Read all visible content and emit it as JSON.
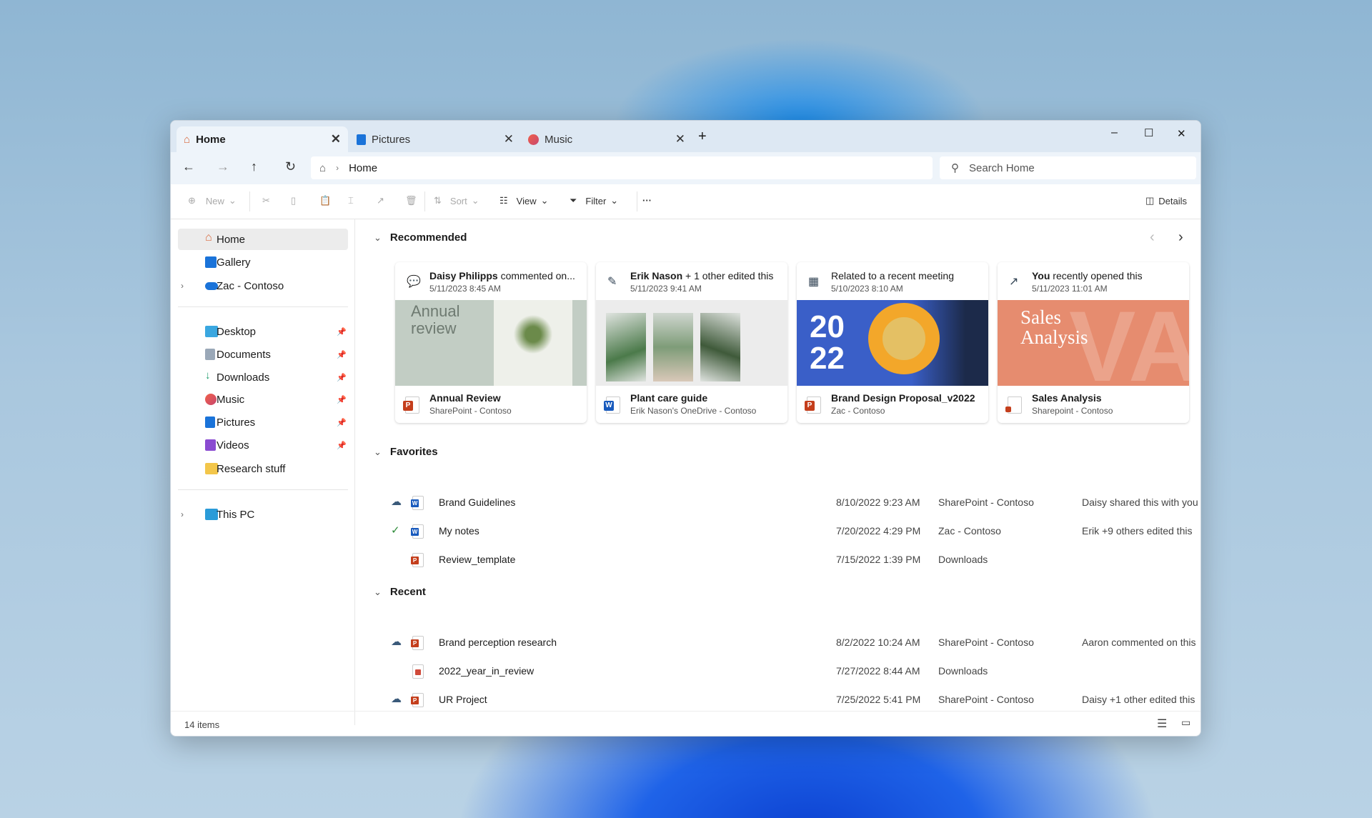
{
  "tabs": [
    {
      "label": "Home",
      "icon": "home-icon",
      "active": true
    },
    {
      "label": "Pictures",
      "icon": "pictures-icon"
    },
    {
      "label": "Music",
      "icon": "music-icon"
    }
  ],
  "window_controls": {
    "minimize": "–",
    "maximize": "☐",
    "close": "✕",
    "new_tab": "+"
  },
  "address": {
    "breadcrumb": [
      "Home"
    ],
    "search_placeholder": "Search Home"
  },
  "toolbar": {
    "new": "New",
    "sort": "Sort",
    "view": "View",
    "filter": "Filter",
    "more": "···",
    "details": "Details"
  },
  "sidebar": {
    "items": [
      {
        "label": "Home",
        "selected": true
      },
      {
        "label": "Gallery"
      },
      {
        "label": "Zac - Contoso"
      },
      {
        "label": "Desktop",
        "pinned": true
      },
      {
        "label": "Documents",
        "pinned": true
      },
      {
        "label": "Downloads",
        "pinned": true
      },
      {
        "label": "Music",
        "pinned": true
      },
      {
        "label": "Pictures",
        "pinned": true
      },
      {
        "label": "Videos",
        "pinned": true
      },
      {
        "label": "Research stuff"
      },
      {
        "label": "This PC"
      }
    ]
  },
  "recommended": {
    "title": "Recommended",
    "cards": [
      {
        "who": "Daisy Philipps",
        "action": " commented on...",
        "time": "5/11/2023 8:45 AM",
        "name": "Annual Review",
        "location": "SharePoint - Contoso",
        "thumb_text": "Annual review",
        "type": "powerpoint"
      },
      {
        "who": "Erik Nason",
        "action": " + 1 other edited this",
        "time": "5/11/2023 9:41 AM",
        "name": "Plant care guide",
        "location": "Erik Nason's OneDrive - Contoso",
        "type": "word"
      },
      {
        "who": "",
        "action": "Related to a recent meeting",
        "time": "5/10/2023 8:10 AM",
        "name": "Brand Design Proposal_v2022",
        "location": "Zac - Contoso",
        "thumb_text": "20 22",
        "type": "powerpoint"
      },
      {
        "who": "You",
        "action": " recently opened this",
        "time": "5/11/2023 11:01 AM",
        "name": "Sales Analysis",
        "location": "Sharepoint - Contoso",
        "thumb_text": "Sales Analysis",
        "type": "document"
      }
    ]
  },
  "favorites": {
    "title": "Favorites",
    "rows": [
      {
        "name": "Brand Guidelines",
        "date": "8/10/2022 9:23 AM",
        "location": "SharePoint - Contoso",
        "activity": "Daisy shared this with you",
        "status": "cloud",
        "type": "word"
      },
      {
        "name": "My notes",
        "date": "7/20/2022 4:29 PM",
        "location": "Zac - Contoso",
        "activity": "Erik +9 others edited this",
        "status": "synced",
        "type": "word"
      },
      {
        "name": "Review_template",
        "date": "7/15/2022 1:39 PM",
        "location": "Downloads",
        "activity": "",
        "status": "",
        "type": "powerpoint"
      }
    ]
  },
  "recent": {
    "title": "Recent",
    "rows": [
      {
        "name": "Brand perception research",
        "date": "8/2/2022 10:24 AM",
        "location": "SharePoint - Contoso",
        "activity": "Aaron commented on this",
        "status": "cloud",
        "type": "powerpoint"
      },
      {
        "name": "2022_year_in_review",
        "date": "7/27/2022 8:44 AM",
        "location": "Downloads",
        "activity": "",
        "status": "",
        "type": "pdf"
      },
      {
        "name": "UR Project",
        "date": "7/25/2022 5:41 PM",
        "location": "SharePoint - Contoso",
        "activity": "Daisy +1 other edited this",
        "status": "cloud",
        "type": "powerpoint"
      }
    ]
  },
  "status": {
    "count": "14 items"
  },
  "colors": {
    "accent": "#0067c0",
    "powerpoint": "#c43e1c",
    "word": "#185abd",
    "selected": "#ececec"
  }
}
